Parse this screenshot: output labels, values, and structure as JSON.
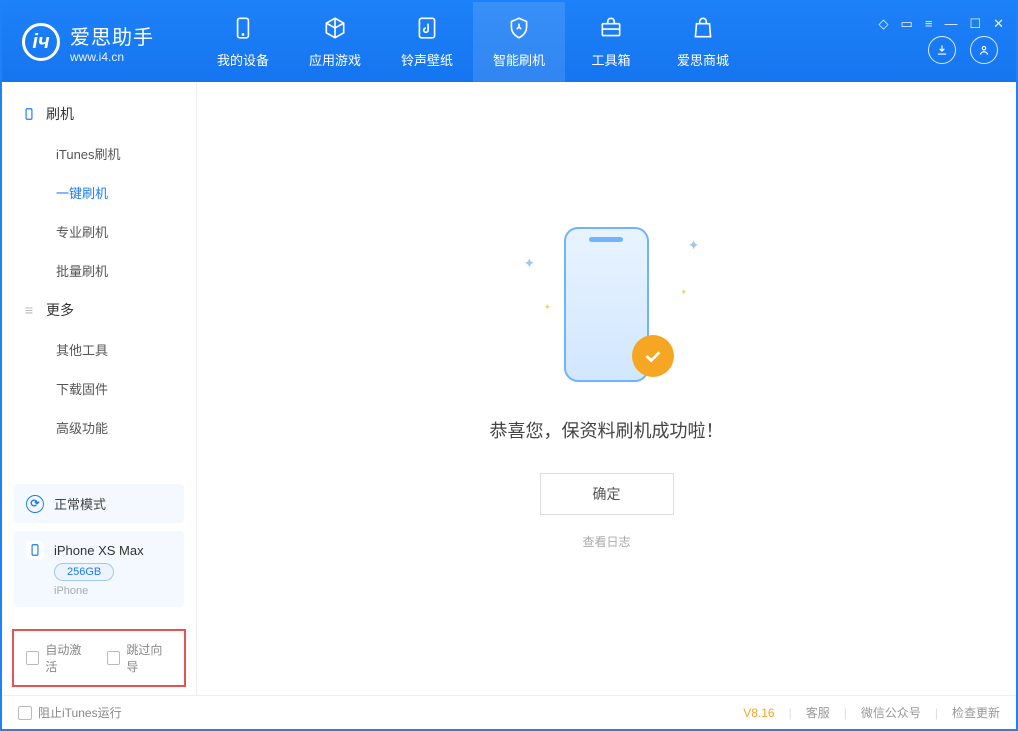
{
  "app": {
    "name": "爱思助手",
    "url": "www.i4.cn"
  },
  "nav": {
    "items": [
      {
        "label": "我的设备",
        "icon": "device-icon"
      },
      {
        "label": "应用游戏",
        "icon": "cube-icon"
      },
      {
        "label": "铃声壁纸",
        "icon": "music-icon"
      },
      {
        "label": "智能刷机",
        "icon": "shield-icon"
      },
      {
        "label": "工具箱",
        "icon": "toolbox-icon"
      },
      {
        "label": "爱思商城",
        "icon": "bag-icon"
      }
    ],
    "activeIndex": 3
  },
  "sidebar": {
    "cat1": {
      "title": "刷机",
      "items": [
        "iTunes刷机",
        "一键刷机",
        "专业刷机",
        "批量刷机"
      ],
      "activeIndex": 1
    },
    "cat2": {
      "title": "更多",
      "items": [
        "其他工具",
        "下载固件",
        "高级功能"
      ]
    }
  },
  "device": {
    "mode": "正常模式",
    "name": "iPhone XS Max",
    "storage": "256GB",
    "type": "iPhone"
  },
  "options": {
    "autoActivate": "自动激活",
    "skipGuide": "跳过向导"
  },
  "main": {
    "successText": "恭喜您，保资料刷机成功啦！",
    "confirmLabel": "确定",
    "logLink": "查看日志"
  },
  "footer": {
    "blockItunes": "阻止iTunes运行",
    "version": "V8.16",
    "links": [
      "客服",
      "微信公众号",
      "检查更新"
    ]
  }
}
